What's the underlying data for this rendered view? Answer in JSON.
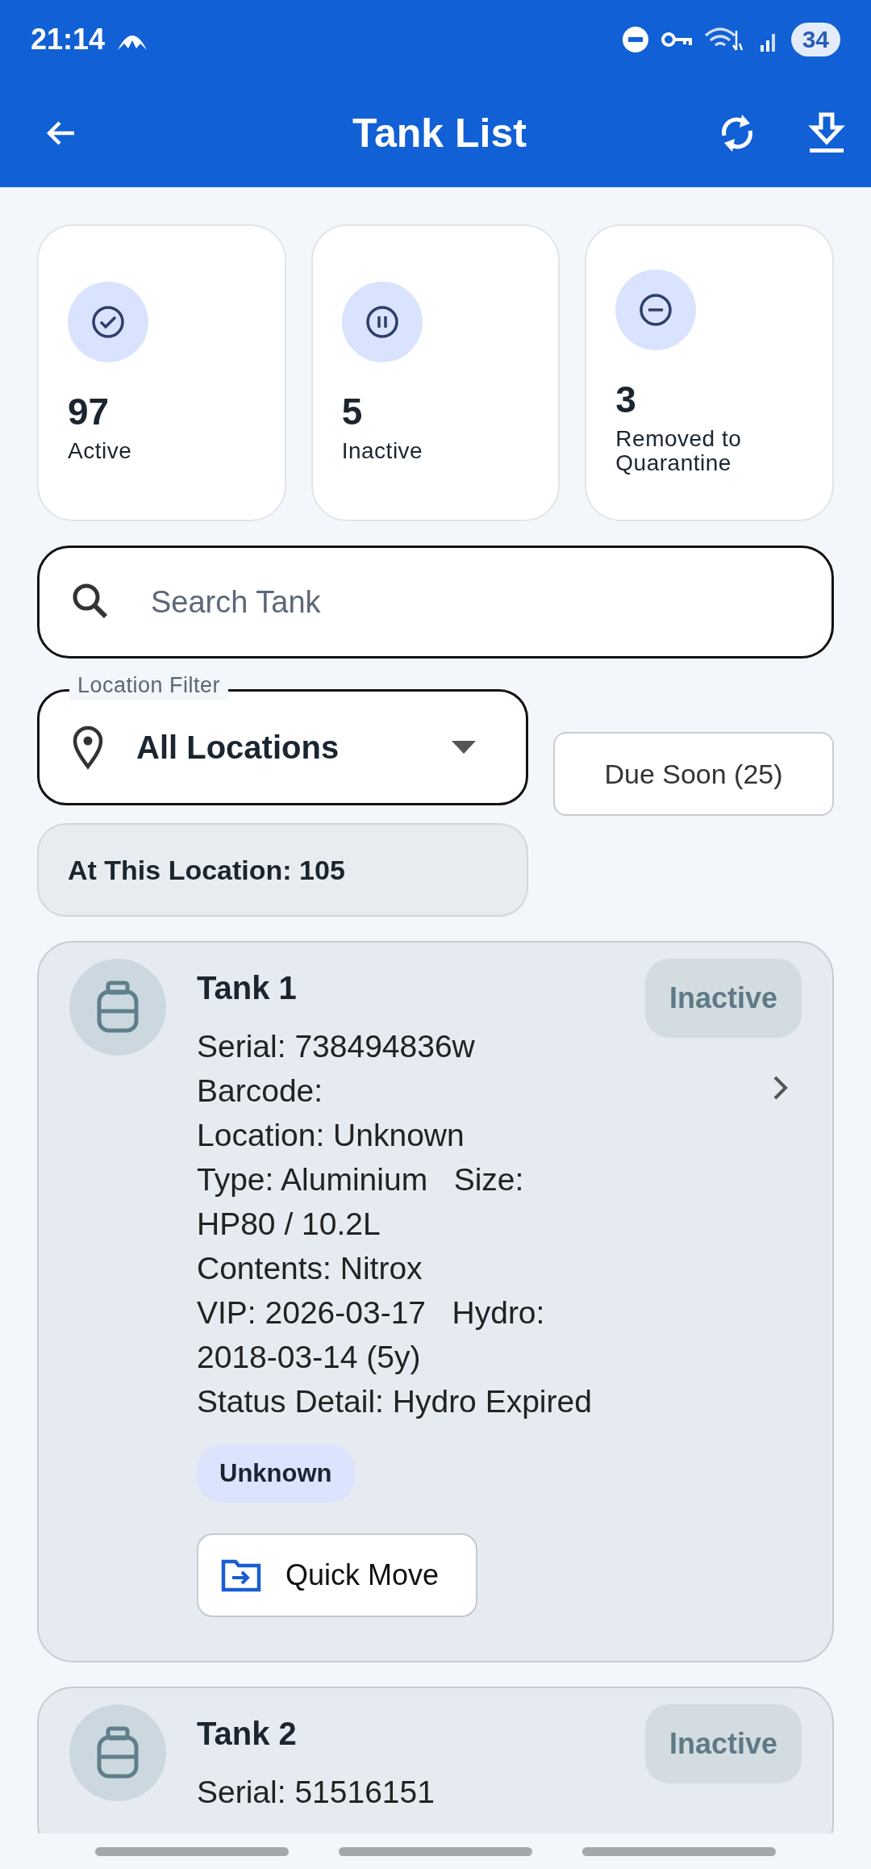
{
  "status_bar": {
    "time": "21:14",
    "battery": "34"
  },
  "app_bar": {
    "title": "Tank List"
  },
  "stats": [
    {
      "kind": "active",
      "count": "97",
      "label": "Active"
    },
    {
      "kind": "inactive",
      "count": "5",
      "label": "Inactive"
    },
    {
      "kind": "quarantine",
      "count": "3",
      "label": "Removed to Quarantine"
    }
  ],
  "search": {
    "placeholder": "Search Tank"
  },
  "location_filter": {
    "label": "Location Filter",
    "value": "All Locations"
  },
  "due_soon_button": "Due Soon (25)",
  "location_count": "At This Location: 105",
  "tanks": [
    {
      "name": "Tank 1",
      "status": "Inactive",
      "details": [
        "Serial: 738494836w",
        "Barcode:",
        "Location: Unknown",
        "Type: Aluminium   Size: HP80 / 10.2L",
        "Contents: Nitrox",
        "VIP: 2026-03-17   Hydro: 2018-03-14 (5y)",
        "Status Detail: Hydro Expired"
      ],
      "location_tag": "Unknown",
      "action": "Quick Move"
    },
    {
      "name": "Tank 2",
      "status": "Inactive",
      "details": [
        "Serial: 51516151"
      ]
    }
  ]
}
